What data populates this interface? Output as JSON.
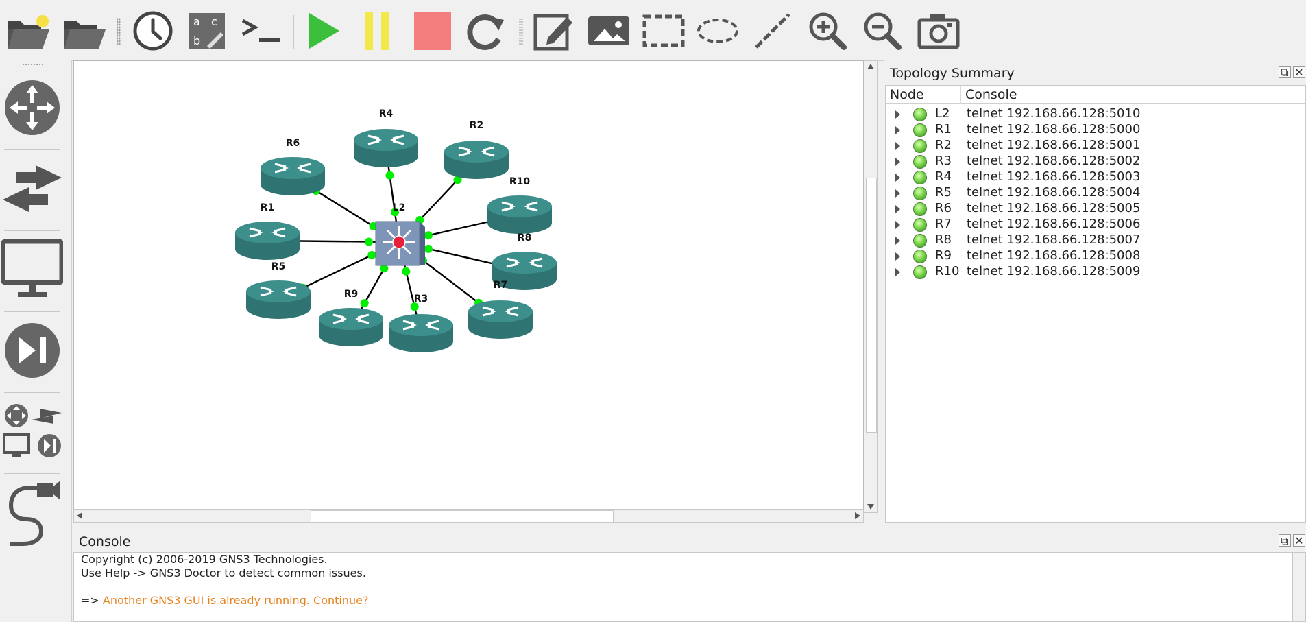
{
  "toolbar": {
    "buttons": [
      {
        "name": "new-project-icon"
      },
      {
        "name": "open-project-icon"
      },
      {
        "name": "snapshot-clock-icon"
      },
      {
        "name": "show-interface-labels-icon"
      },
      {
        "name": "console-all-icon"
      },
      {
        "name": "start-all-icon"
      },
      {
        "name": "suspend-all-icon"
      },
      {
        "name": "stop-all-icon"
      },
      {
        "name": "reload-all-icon"
      },
      {
        "name": "add-note-icon"
      },
      {
        "name": "insert-image-icon"
      },
      {
        "name": "draw-rectangle-icon"
      },
      {
        "name": "draw-ellipse-icon"
      },
      {
        "name": "draw-line-icon"
      },
      {
        "name": "zoom-in-icon"
      },
      {
        "name": "zoom-out-icon"
      },
      {
        "name": "screenshot-icon"
      }
    ],
    "colors": {
      "start": "#3cbf3c",
      "suspend": "#f2e84a",
      "stop": "#f47e7e"
    }
  },
  "left_dock": {
    "items": [
      "routers-icon",
      "switches-icon",
      "end-devices-icon",
      "security-devices-icon",
      "all-devices-icon",
      "add-link-icon"
    ]
  },
  "topology": {
    "nodes": [
      {
        "label": "L2",
        "type": "switch"
      },
      {
        "label": "R1",
        "type": "router"
      },
      {
        "label": "R2",
        "type": "router"
      },
      {
        "label": "R3",
        "type": "router"
      },
      {
        "label": "R4",
        "type": "router"
      },
      {
        "label": "R5",
        "type": "router"
      },
      {
        "label": "R6",
        "type": "router"
      },
      {
        "label": "R7",
        "type": "router"
      },
      {
        "label": "R8",
        "type": "router"
      },
      {
        "label": "R9",
        "type": "router"
      },
      {
        "label": "R10",
        "type": "router"
      }
    ],
    "link_status_color": "#00ee00",
    "router_color": "#3d8f8c"
  },
  "topology_summary": {
    "title": "Topology Summary",
    "columns": [
      "Node",
      "Console"
    ],
    "rows": [
      {
        "node": "L2",
        "console": "telnet 192.168.66.128:5010"
      },
      {
        "node": "R1",
        "console": "telnet 192.168.66.128:5000"
      },
      {
        "node": "R2",
        "console": "telnet 192.168.66.128:5001"
      },
      {
        "node": "R3",
        "console": "telnet 192.168.66.128:5002"
      },
      {
        "node": "R4",
        "console": "telnet 192.168.66.128:5003"
      },
      {
        "node": "R5",
        "console": "telnet 192.168.66.128:5004"
      },
      {
        "node": "R6",
        "console": "telnet 192.168.66.128:5005"
      },
      {
        "node": "R7",
        "console": "telnet 192.168.66.128:5006"
      },
      {
        "node": "R8",
        "console": "telnet 192.168.66.128:5007"
      },
      {
        "node": "R9",
        "console": "telnet 192.168.66.128:5008"
      },
      {
        "node": "R10",
        "console": "telnet 192.168.66.128:5009"
      }
    ],
    "status_color": "#5fce3a"
  },
  "console": {
    "title": "Console",
    "lines": [
      "Copyright (c) 2006-2019 GNS3 Technologies.",
      "Use Help -> GNS3 Doctor to detect common issues."
    ],
    "prompt": "=> ",
    "warning": "Another GNS3 GUI is already running. Continue?",
    "warning_color": "#e8821e"
  },
  "window_controls": {
    "float": "⧉",
    "close": "✕"
  }
}
